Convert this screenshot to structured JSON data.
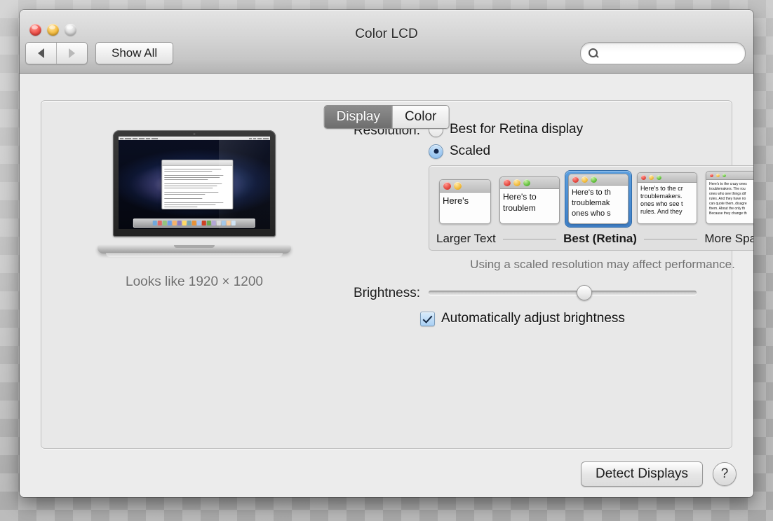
{
  "window": {
    "title": "Color LCD",
    "traffic_lights": [
      "close",
      "minimize",
      "zoom"
    ],
    "nav": {
      "back_label": "◀",
      "forward_label": "▶"
    },
    "show_all_label": "Show All",
    "search": {
      "value": "",
      "placeholder": ""
    }
  },
  "tabs": [
    {
      "label": "Display",
      "active": true
    },
    {
      "label": "Color",
      "active": false
    }
  ],
  "preview": {
    "looks_like": "Looks like 1920 × 1200",
    "device": "macbook-pro-retina"
  },
  "resolution": {
    "label": "Resolution:",
    "options": [
      {
        "label": "Best for Retina display",
        "selected": false
      },
      {
        "label": "Scaled",
        "selected": true
      }
    ],
    "scale_thumbnails": [
      {
        "index": 0,
        "selected": false,
        "lines": [
          "Here's"
        ],
        "font_size": 13,
        "dots": 2,
        "dot_size": 11
      },
      {
        "index": 1,
        "selected": false,
        "lines": [
          "Here's to",
          "troublem"
        ],
        "font_size": 12,
        "dots": 3,
        "dot_size": 10
      },
      {
        "index": 2,
        "selected": true,
        "lines": [
          "Here's to th",
          "troublemak",
          "ones who s"
        ],
        "font_size": 11,
        "dots": 3,
        "dot_size": 9
      },
      {
        "index": 3,
        "selected": false,
        "lines": [
          "Here's to the cr",
          "troublemakers.",
          "ones who see t",
          "rules. And they"
        ],
        "font_size": 9,
        "dots": 3,
        "dot_size": 7
      },
      {
        "index": 4,
        "selected": false,
        "lines": [
          "Here's to the crazy ones",
          "troublemakers. The rou",
          "ones who see things dif",
          "rules. And they have no",
          "can quote them, disagre",
          "them. About the only th",
          "Because they change th"
        ],
        "font_size": 5,
        "dots": 3,
        "dot_size": 5
      }
    ],
    "scale_labels": {
      "left": "Larger Text",
      "middle": "Best (Retina)",
      "right": "More Space"
    },
    "performance_note": "Using a scaled resolution may affect performance."
  },
  "brightness": {
    "label": "Brightness:",
    "value_percent": 58,
    "auto_adjust": {
      "label": "Automatically adjust brightness",
      "checked": true
    }
  },
  "footer": {
    "detect_displays_label": "Detect Displays",
    "help_label": "?"
  },
  "colors": {
    "accent_blue": "#3f7fc6",
    "window_bg": "#ececec",
    "panel_bg": "#e8e8e8",
    "note_gray": "#6f6f6f"
  }
}
